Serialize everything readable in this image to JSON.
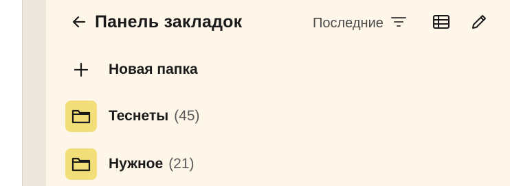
{
  "header": {
    "title": "Панель закладок",
    "sort_label": "Последние",
    "icons": {
      "back": "arrow-left-icon",
      "sort": "filter-lines-icon",
      "view": "table-view-icon",
      "edit": "pencil-icon"
    }
  },
  "new_folder": {
    "label": "Новая папка",
    "icon": "plus-icon"
  },
  "folders": [
    {
      "name": "Теснеты",
      "count": "(45)",
      "icon": "folder-icon"
    },
    {
      "name": "Нужное",
      "count": "(21)",
      "icon": "folder-icon"
    }
  ],
  "colors": {
    "panel_background": "#fdf6e9",
    "gutter_background": "#ece8de",
    "folder_tile": "#f3df7a",
    "text_primary": "#1a1a1a",
    "text_secondary": "#5a5a5a"
  }
}
